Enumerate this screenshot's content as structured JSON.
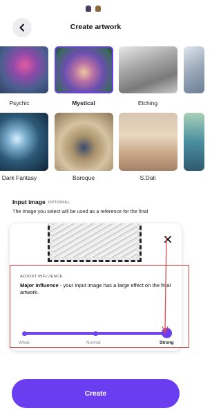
{
  "header": {
    "title": "Create artwork"
  },
  "styles": [
    {
      "label": "Psychic",
      "selected": false
    },
    {
      "label": "Mystical",
      "selected": true
    },
    {
      "label": "Etching",
      "selected": false
    },
    {
      "label": "Dark Fantasy",
      "selected": false
    },
    {
      "label": "Baroque",
      "selected": false
    },
    {
      "label": "S.Dali",
      "selected": false
    }
  ],
  "input_image": {
    "title": "Input image",
    "optional_tag": "OPTIONAL",
    "description": "The image you select will be used as a reference for the final"
  },
  "influence": {
    "section_label": "ADJUST INFLUENCE",
    "level_title": "Major influence",
    "level_description": " - your input image has a large effect on the final artwork.",
    "options": [
      "Weak",
      "Normal",
      "Strong"
    ],
    "selected": "Strong"
  },
  "actions": {
    "create_label": "Create"
  },
  "colors": {
    "accent": "#6a3df0",
    "annotation": "#e04848"
  }
}
